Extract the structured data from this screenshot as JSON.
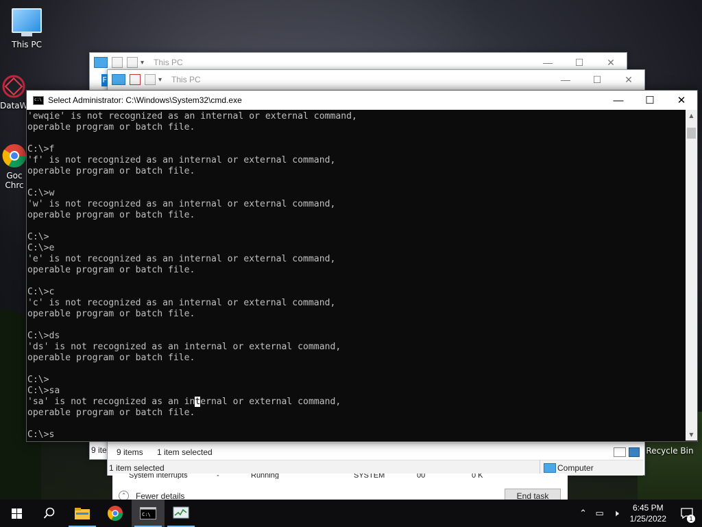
{
  "desktop": {
    "icons": [
      {
        "label": "This PC",
        "icon": "monitor-icon"
      },
      {
        "label": "DataW",
        "icon": "app-icon"
      },
      {
        "label": "Goc",
        "icon": "chrome-icon"
      },
      {
        "label": "Chrc",
        "icon": "chrome-icon"
      },
      {
        "label": "Recycle Bin",
        "icon": "recycle-bin-icon"
      }
    ]
  },
  "explorer_back": {
    "title": "This PC",
    "status_items": "9 ite"
  },
  "explorer_front": {
    "title": "This PC",
    "ribbon_tab": "F",
    "status_items": "9 items",
    "status_selected": "1 item selected",
    "detail_selected": "1 item selected",
    "location": "Computer"
  },
  "cmd": {
    "title": "Select Administrator: C:\\Windows\\System32\\cmd.exe",
    "lines": [
      "'ewqie' is not recognized as an internal or external command,",
      "operable program or batch file.",
      "",
      "C:\\>f",
      "'f' is not recognized as an internal or external command,",
      "operable program or batch file.",
      "",
      "C:\\>w",
      "'w' is not recognized as an internal or external command,",
      "operable program or batch file.",
      "",
      "C:\\>",
      "C:\\>e",
      "'e' is not recognized as an internal or external command,",
      "operable program or batch file.",
      "",
      "C:\\>c",
      "'c' is not recognized as an internal or external command,",
      "operable program or batch file.",
      "",
      "C:\\>ds",
      "'ds' is not recognized as an internal or external command,",
      "operable program or batch file.",
      "",
      "C:\\>",
      "C:\\>sa"
    ],
    "selected_line": {
      "before": "'sa' is not recognized as an in",
      "selected": "t",
      "after": "ernal or external command,"
    },
    "tail_lines": [
      "operable program or batch file.",
      "",
      "C:\\>s"
    ]
  },
  "taskmgr": {
    "row": {
      "name": "System interrupts",
      "pid": "-",
      "status": "Running",
      "user": "SYSTEM",
      "cpu": "00",
      "memory": "0 K"
    },
    "fewer_details": "Fewer details",
    "end_task": "End task"
  },
  "taskbar": {
    "apps": [
      "start-icon",
      "search-icon",
      "file-explorer-icon",
      "chrome-icon",
      "cmd-icon",
      "task-manager-icon"
    ],
    "time": "6:45 PM",
    "date": "1/25/2022",
    "notification_count": "1"
  }
}
